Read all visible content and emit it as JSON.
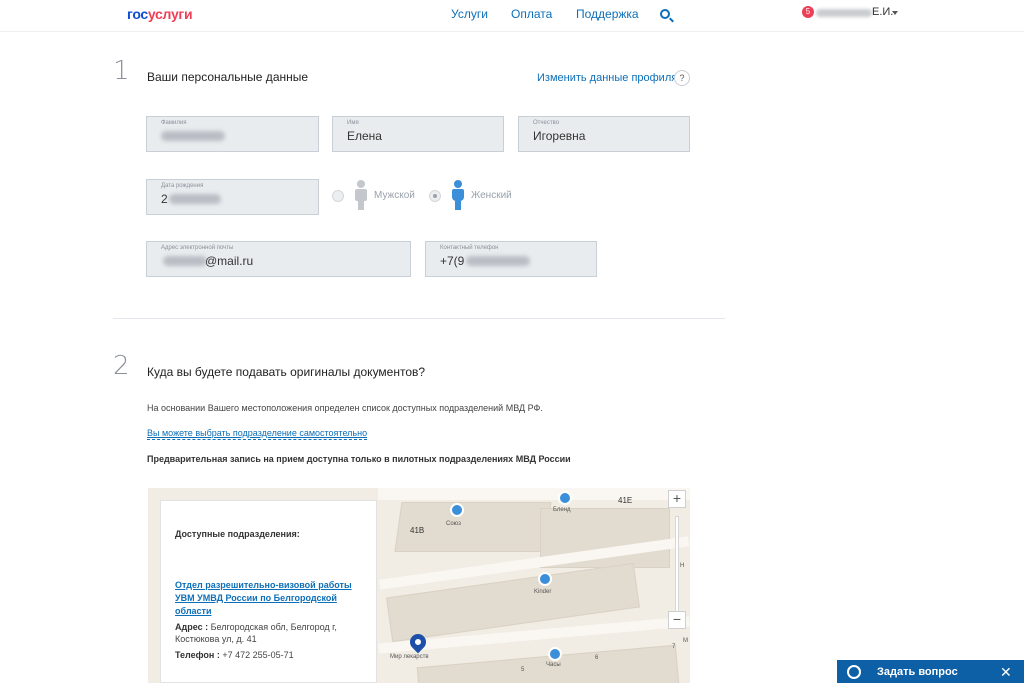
{
  "header": {
    "logo_part1": "гос",
    "logo_part2": "услуги",
    "nav": [
      "Услуги",
      "Оплата",
      "Поддержка"
    ],
    "notifications_count": "5",
    "user_name": "Е.И."
  },
  "step1": {
    "number": "1",
    "title": "Ваши персональные данные",
    "edit_link": "Изменить данные профиля",
    "help": "?",
    "fields": {
      "surname": {
        "label": "Фамилия",
        "value": ""
      },
      "name": {
        "label": "Имя",
        "value": "Елена"
      },
      "patronymic": {
        "label": "Отчество",
        "value": "Игоревна"
      },
      "birthdate": {
        "label": "Дата рождения",
        "value": "2"
      },
      "email": {
        "label": "Адрес электронной почты",
        "value": "@mail.ru"
      },
      "phone": {
        "label": "Контактный телефон",
        "value": "+7(9"
      }
    },
    "gender": {
      "male": "Мужской",
      "female": "Женский",
      "selected": "female"
    }
  },
  "step2": {
    "number": "2",
    "title": "Куда вы будете подавать оригиналы документов?",
    "info": "На основании Вашего местоположения определен список доступных подразделений МВД РФ.",
    "choose_link": "Вы можете выбрать подразделение самостоятельно",
    "notice": "Предварительная запись на прием доступна только в пилотных подразделениях МВД России"
  },
  "map": {
    "panel_title": "Доступные подразделения:",
    "office_link": "Отдел разрешительно-визовой работы УВМ УМВД России по Белгородской области",
    "address_label": "Адрес :",
    "address_value": "Белгородская обл, Белгород г, Костюкова ул, д. 41",
    "phone_label": "Телефон :",
    "phone_value": "+7 472 255-05-71",
    "labels": {
      "b41v": "41В",
      "b41e": "41Е",
      "mir": "Мир лекарств",
      "kinder": "Kinder",
      "poi_1": "Союз",
      "poi_2": "Бленд",
      "poi_3": "Часы",
      "n5": "5",
      "n6": "6",
      "n7": "7",
      "h": "Н",
      "m": "М"
    },
    "zoom_in": "+",
    "zoom_out": "−"
  },
  "ask": {
    "label": "Задать вопрос",
    "close": "✕"
  }
}
